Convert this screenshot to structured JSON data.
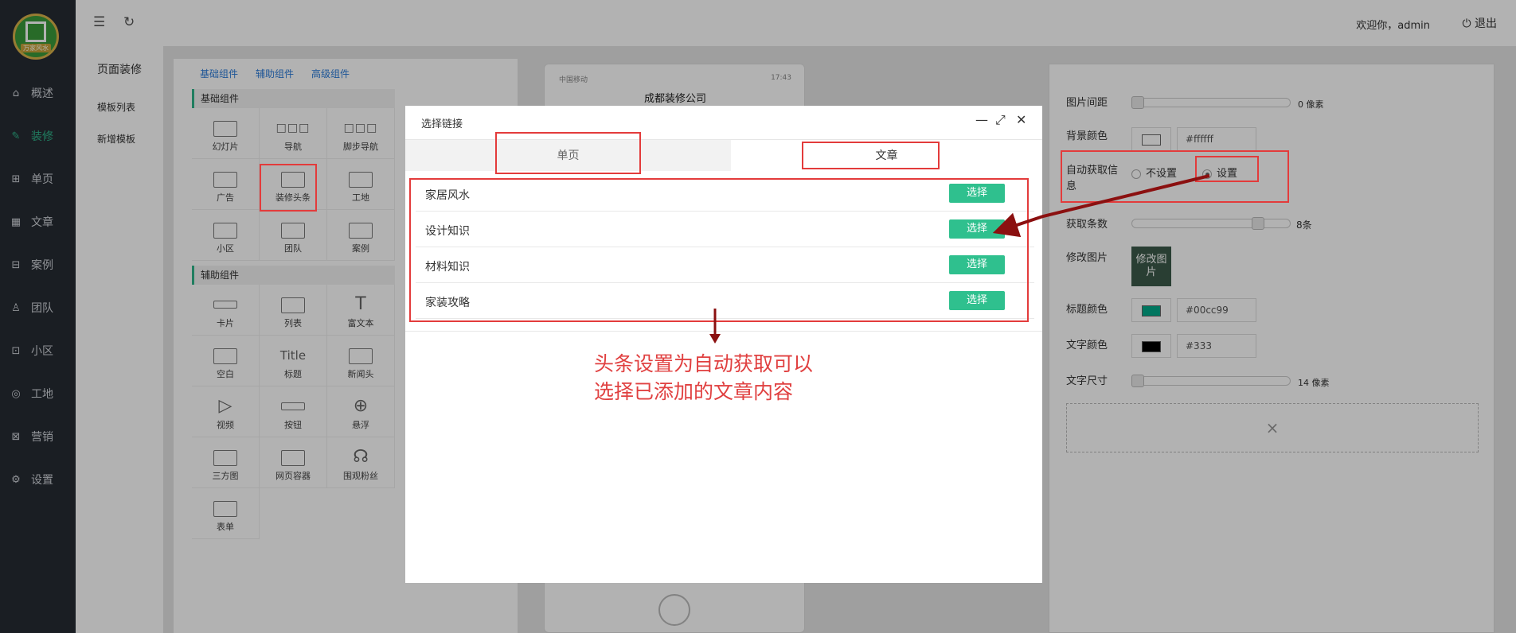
{
  "header": {
    "welcome": "欢迎你，admin",
    "logout": "退出"
  },
  "logo": {
    "text": "万家风水"
  },
  "sidebar": {
    "items": [
      {
        "label": "概述",
        "icon": "home-icon"
      },
      {
        "label": "装修",
        "icon": "brush-icon"
      },
      {
        "label": "单页",
        "icon": "page-icon"
      },
      {
        "label": "文章",
        "icon": "grid-icon"
      },
      {
        "label": "案例",
        "icon": "case-icon"
      },
      {
        "label": "团队",
        "icon": "user-icon"
      },
      {
        "label": "小区",
        "icon": "building-icon"
      },
      {
        "label": "工地",
        "icon": "location-icon"
      },
      {
        "label": "营销",
        "icon": "ticket-icon"
      },
      {
        "label": "设置",
        "icon": "gear-icon"
      }
    ]
  },
  "subnav": {
    "title": "页面装修",
    "items": [
      "模板列表",
      "新增模板"
    ]
  },
  "components": {
    "tabs": [
      "基础组件",
      "辅助组件",
      "高级组件"
    ],
    "basic_title": "基础组件",
    "basic": [
      "幻灯片",
      "导航",
      "脚步导航",
      "广告",
      "装修头条",
      "工地",
      "小区",
      "团队",
      "案例"
    ],
    "aux_title": "辅助组件",
    "aux": [
      "卡片",
      "列表",
      "富文本",
      "空白",
      "标题",
      "新闻头",
      "视频",
      "按钮",
      "悬浮",
      "三方图",
      "网页容器",
      "围观粉丝",
      "表单"
    ],
    "title_glyph": "Title"
  },
  "phone": {
    "carrier": "中国移动",
    "time": "17:43",
    "title": "成都装修公司"
  },
  "props": {
    "image_spacing": {
      "label": "图片间距",
      "value": "0 像素"
    },
    "bg_color": {
      "label": "背景颜色",
      "value": "#ffffff",
      "color": "#ffffff"
    },
    "auto_fetch": {
      "label": "自动获取信息",
      "options": [
        "不设置",
        "设置"
      ],
      "selected": "设置"
    },
    "fetch_count": {
      "label": "获取条数",
      "value": "8条",
      "level": 0.8
    },
    "edit_image": {
      "label": "修改图片",
      "thumb_text": "修改图片"
    },
    "title_color": {
      "label": "标题颜色",
      "value": "#00cc99",
      "color": "#00cc99"
    },
    "text_color": {
      "label": "文字颜色",
      "value": "#333",
      "color": "#000000"
    },
    "font_size": {
      "label": "文字尺寸",
      "value": "14 像素"
    },
    "close_glyph": "×"
  },
  "modal": {
    "title": "选择链接",
    "tabs": [
      "单页",
      "文章"
    ],
    "active_tab": "文章",
    "rows": [
      {
        "title": "家居风水",
        "action": "选择"
      },
      {
        "title": "设计知识",
        "action": "选择"
      },
      {
        "title": "材料知识",
        "action": "选择"
      },
      {
        "title": "家装攻略",
        "action": "选择"
      }
    ]
  },
  "annotation": {
    "line1": "头条设置为自动获取可以",
    "line2": "选择已添加的文章内容"
  },
  "colors": {
    "accent": "#2fb58a",
    "button": "#2fc08e",
    "annotation": "#e33b3b",
    "sidebar": "#262b33"
  }
}
